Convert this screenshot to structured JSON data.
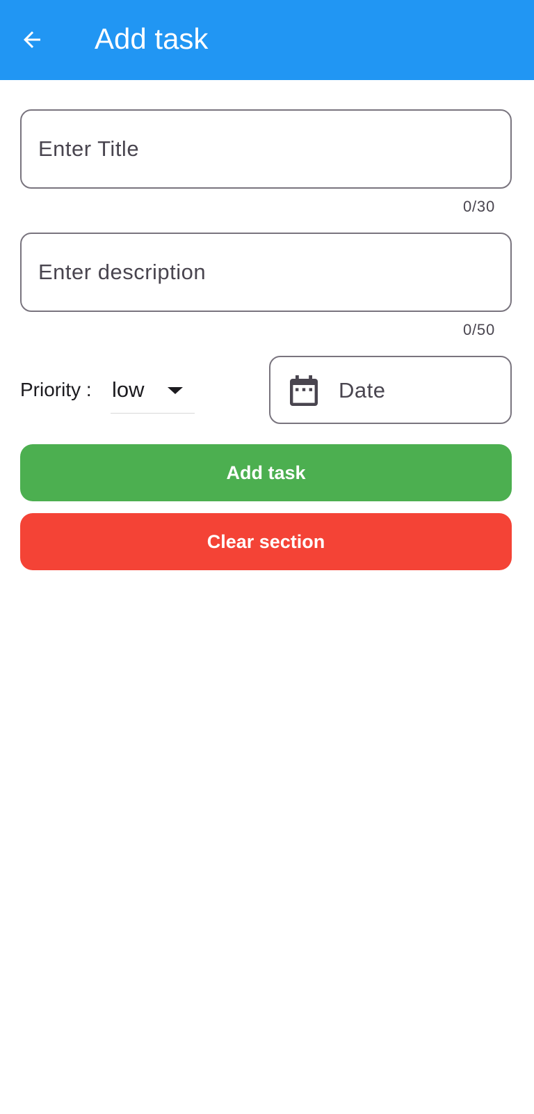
{
  "appbar": {
    "title": "Add task",
    "back_icon": "arrow-left-icon",
    "color": "#2196F3"
  },
  "form": {
    "title_field": {
      "value": "",
      "placeholder": "Enter Title",
      "counter": "0/30"
    },
    "description_field": {
      "value": "",
      "placeholder": "Enter description",
      "counter": "0/50"
    },
    "priority": {
      "label": "Priority :",
      "selected": "low"
    },
    "date": {
      "label": "Date",
      "icon": "calendar-icon"
    }
  },
  "actions": {
    "add_label": "Add task",
    "add_color": "#4CAF50",
    "clear_label": "Clear section",
    "clear_color": "#F44336"
  }
}
